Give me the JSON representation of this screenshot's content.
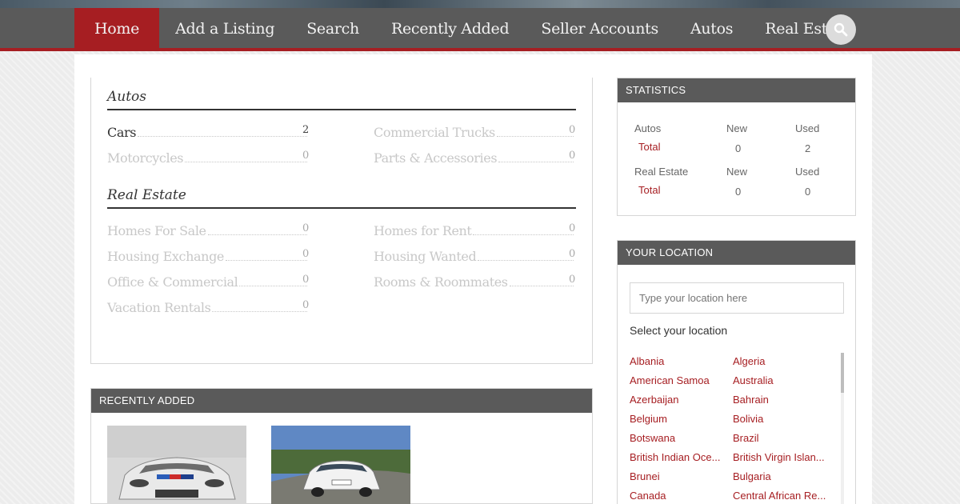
{
  "nav": {
    "items": [
      "Home",
      "Add a Listing",
      "Search",
      "Recently Added",
      "Seller Accounts",
      "Autos",
      "Real Estate"
    ],
    "active": "Home",
    "search_icon": "search-icon"
  },
  "categories": {
    "groups": [
      {
        "title": "Autos",
        "items": [
          {
            "name": "Cars",
            "count": "2"
          },
          {
            "name": "Commercial Trucks",
            "count": "0"
          },
          {
            "name": "Motorcycles",
            "count": "0"
          },
          {
            "name": "Parts & Accessories",
            "count": "0"
          }
        ]
      },
      {
        "title": "Real Estate",
        "items": [
          {
            "name": "Homes For Sale",
            "count": "0"
          },
          {
            "name": "Homes for Rent",
            "count": "0"
          },
          {
            "name": "Housing Exchange",
            "count": "0"
          },
          {
            "name": "Housing Wanted",
            "count": "0"
          },
          {
            "name": "Office & Commercial",
            "count": "0"
          },
          {
            "name": "Rooms & Roommates",
            "count": "0"
          },
          {
            "name": "Vacation Rentals",
            "count": "0"
          }
        ]
      }
    ]
  },
  "recent": {
    "title": "RECENTLY ADDED"
  },
  "statistics": {
    "title": "STATISTICS",
    "rows": [
      {
        "category": "Autos",
        "new_label": "New",
        "used_label": "Used",
        "total_label": "Total",
        "new": "0",
        "used": "2"
      },
      {
        "category": "Real Estate",
        "new_label": "New",
        "used_label": "Used",
        "total_label": "Total",
        "new": "0",
        "used": "0"
      }
    ]
  },
  "location": {
    "title": "YOUR LOCATION",
    "placeholder": "Type your location here",
    "select_label": "Select your location",
    "countries": [
      "Albania",
      "Algeria",
      "American Samoa",
      "Australia",
      "Azerbaijan",
      "Bahrain",
      "Belgium",
      "Bolivia",
      "Botswana",
      "Brazil",
      "British Indian Oce...",
      "British Virgin Islan...",
      "Brunei",
      "Bulgaria",
      "Canada",
      "Central African Re..."
    ]
  },
  "colors": {
    "accent": "#a61e22",
    "nav_bg": "#5a5a5a",
    "panel_head": "#5a5a5a"
  }
}
